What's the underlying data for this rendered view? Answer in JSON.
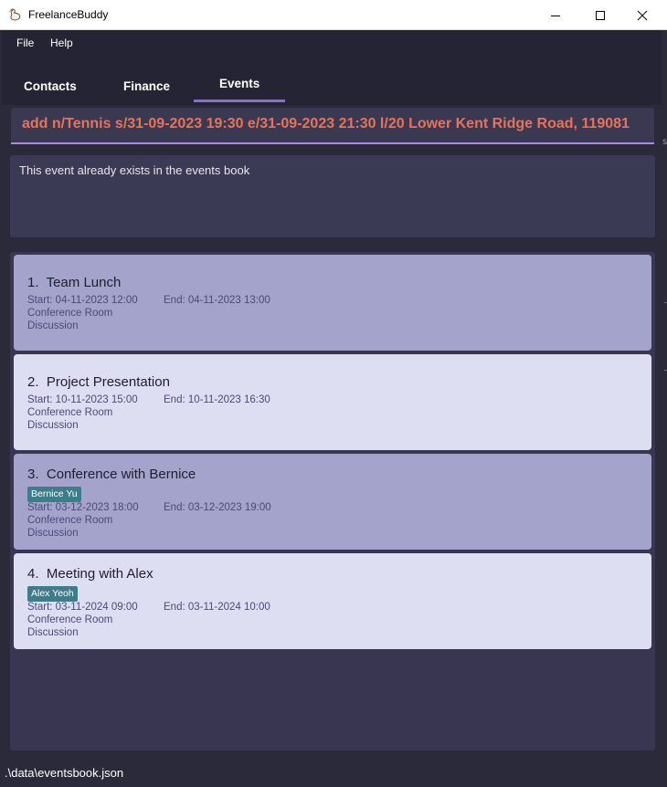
{
  "window": {
    "title": "FreelanceBuddy"
  },
  "menu": {
    "file": "File",
    "help": "Help"
  },
  "tabs": {
    "contacts": "Contacts",
    "finance": "Finance",
    "events": "Events"
  },
  "command": {
    "value": "add n/Tennis s/31-09-2023 19:30 e/31-09-2023 21:30 l/20 Lower Kent Ridge Road, 119081"
  },
  "result": {
    "message": "This event already exists in the events book"
  },
  "events": [
    {
      "index": "1.",
      "name": "Team Lunch",
      "contact": "",
      "start": "Start: 04-11-2023 12:00",
      "end": "End: 04-11-2023 13:00",
      "location": "Conference Room",
      "description": "Discussion"
    },
    {
      "index": "2.",
      "name": "Project Presentation",
      "contact": "",
      "start": "Start: 10-11-2023 15:00",
      "end": "End: 10-11-2023 16:30",
      "location": "Conference Room",
      "description": "Discussion"
    },
    {
      "index": "3.",
      "name": "Conference with Bernice",
      "contact": "Bernice Yu",
      "start": "Start: 03-12-2023 18:00",
      "end": "End: 03-12-2023 19:00",
      "location": "Conference Room",
      "description": "Discussion"
    },
    {
      "index": "4.",
      "name": "Meeting with Alex",
      "contact": "Alex Yeoh",
      "start": "Start: 03-11-2024 09:00",
      "end": "End: 03-11-2024 10:00",
      "location": "Conference Room",
      "description": "Discussion"
    }
  ],
  "status": {
    "path": ".\\data\\eventsbook.json"
  },
  "colors": {
    "accent": "#8a6be0",
    "command_text": "#e8725a",
    "tag": "#3f7c8a",
    "card_dark": "#a3a3cc",
    "card_light": "#dedef3"
  }
}
